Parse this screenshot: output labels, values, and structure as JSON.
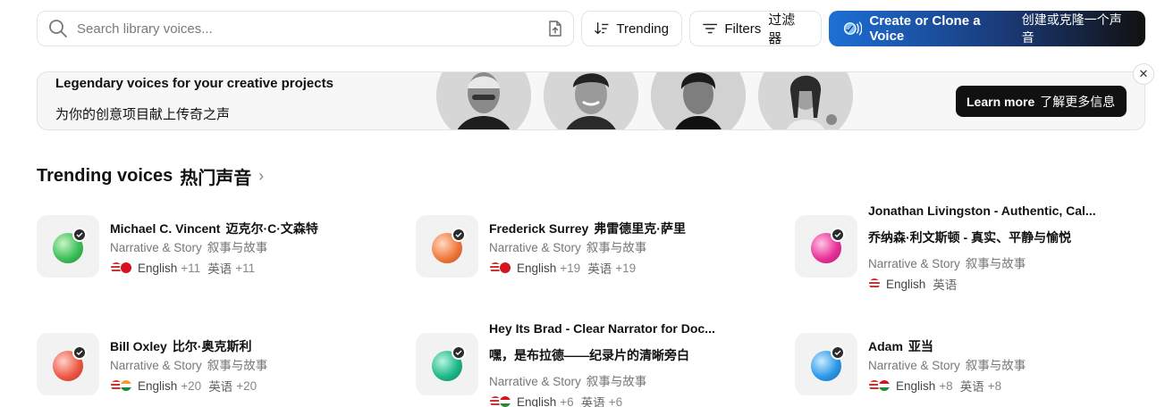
{
  "search": {
    "placeholder": "Search library voices..."
  },
  "toolbar": {
    "trending_label": "Trending",
    "filters_label": "Filters",
    "filters_label_zh": "过滤 器",
    "create_label": "Create or Clone a Voice",
    "create_label_zh": "创建或克隆一个声音"
  },
  "banner": {
    "title": "Legendary voices for your creative projects",
    "subtitle": "为你的创意项目献上传奇之声",
    "learn_label": "Learn more",
    "learn_label_zh": "了解更多信息",
    "close_label": "✕"
  },
  "section": {
    "title": "Trending voices",
    "title_zh": "热门声音",
    "chevron": "›"
  },
  "voices": [
    {
      "name": "Michael C. Vincent",
      "name_zh": "迈克尔·C·文森特",
      "category": "Narrative & Story",
      "category_zh": "叙事与故事",
      "language": "English",
      "more": "+11",
      "language_zh": "英语",
      "more_zh": "+11",
      "color": "#3ec05a"
    },
    {
      "name": "Frederick Surrey",
      "name_zh": "弗雷德里克·萨里",
      "category": "Narrative & Story",
      "category_zh": "叙事与故事",
      "language": "English",
      "more": "+19",
      "language_zh": "英语",
      "more_zh": "+19",
      "color": "#f07a3e"
    },
    {
      "name": "Jonathan Livingston - Authentic, Cal...",
      "name_zh": "乔纳森·利文斯顿 - 真实、平静与愉悦",
      "category": "Narrative & Story",
      "category_zh": "叙事与故事",
      "language": "English",
      "more": "",
      "language_zh": "英语",
      "more_zh": "",
      "color": "#e8339a"
    },
    {
      "name": "Bill Oxley",
      "name_zh": "比尔·奥克斯利",
      "category": "Narrative & Story",
      "category_zh": "叙事与故事",
      "language": "English",
      "more": "+20",
      "language_zh": "英语",
      "more_zh": "+20",
      "color": "#ee5c48"
    },
    {
      "name": "Hey Its Brad - Clear Narrator for Doc...",
      "name_zh": "嘿，是布拉德——纪录片的清晰旁白",
      "category": "Narrative & Story",
      "category_zh": "叙事与故事",
      "language": "English",
      "more": "+6",
      "language_zh": "英语",
      "more_zh": "+6",
      "color": "#1fb98a"
    },
    {
      "name": "Adam",
      "name_zh": "亚当",
      "category": "Narrative & Story",
      "category_zh": "叙事与故事",
      "language": "English",
      "more": "+8",
      "language_zh": "英语",
      "more_zh": "+8",
      "color": "#2f9ae8"
    }
  ]
}
